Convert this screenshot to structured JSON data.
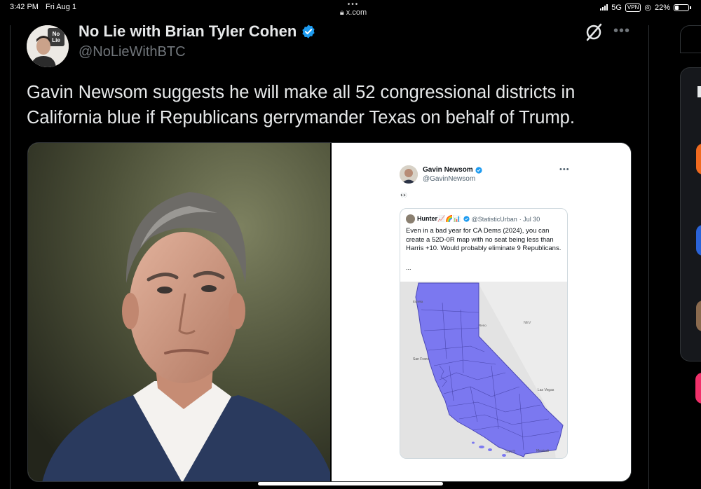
{
  "status_bar": {
    "time": "3:42 PM",
    "date": "Fri Aug 1",
    "url": "x.com",
    "network": "5G",
    "vpn": "VPN",
    "battery": "22%"
  },
  "tweet": {
    "author_name": "No Lie with Brian Tyler Cohen",
    "author_handle": "@NoLieWithBTC",
    "avatar_text_line1": "No",
    "avatar_text_line2": "Lie",
    "text": "Gavin Newsom suggests he will make all 52 congressional districts in California blue if Republicans gerrymander Texas on behalf of Trump.",
    "more_label": "•••"
  },
  "embedded_post": {
    "author_name": "Gavin Newsom",
    "author_handle": "@GavinNewsom",
    "more_label": "•••",
    "body_emoji": "👀",
    "quoted": {
      "author_name": "Hunter📈🌈📊",
      "author_handle": "@StatisticUrban",
      "date": "· Jul 30",
      "text": "Even in a bad year for CA Dems (2024), you can create a 52D-0R map with no seat being less than Harris +10. Would probably eliminate 9 Republicans.",
      "ellipsis": "...",
      "map_labels": {
        "state": "NEV",
        "city_sf": "San Franc",
        "city_lv": "Las Vegas",
        "city_sd": "San D",
        "country": "Mexicali",
        "reno": "Reno",
        "eureka": "Eureka"
      }
    }
  },
  "colors": {
    "background": "#000000",
    "verified": "#1d9bf0",
    "district_fill": "#7b78f0",
    "text_primary": "#e7e9ea",
    "text_secondary": "#71767b"
  }
}
